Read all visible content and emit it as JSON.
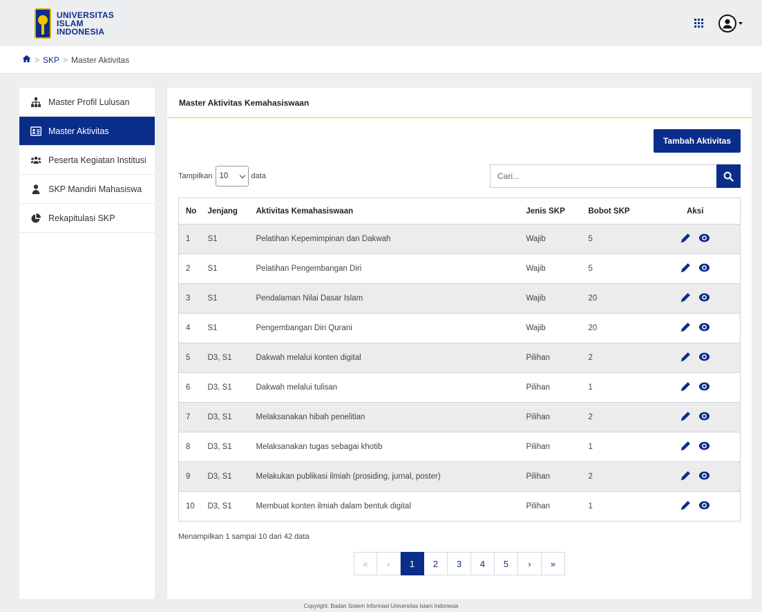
{
  "brand": {
    "line1": "UNIVERSITAS",
    "line2": "ISLAM",
    "line3": "INDONESIA",
    "color": "#0b2d8a",
    "accent": "#e7c24a"
  },
  "topbar": {
    "apps_icon": "apps-grid-icon",
    "user_icon": "user-circle-icon"
  },
  "breadcrumb": {
    "home_icon": "home-icon",
    "sep": ">",
    "items": [
      "SKP",
      "Master Aktivitas"
    ]
  },
  "sidebar": {
    "items": [
      {
        "label": "Master Profil Lulusan",
        "icon": "sitemap-icon",
        "active": false
      },
      {
        "label": "Master Aktivitas",
        "icon": "id-card-icon",
        "active": true
      },
      {
        "label": "Peserta Kegiatan Institusi",
        "icon": "users-icon",
        "active": false
      },
      {
        "label": "SKP Mandiri Mahasiswa",
        "icon": "user-icon",
        "active": false
      },
      {
        "label": "Rekapitulasi SKP",
        "icon": "pie-chart-icon",
        "active": false
      }
    ]
  },
  "main": {
    "title": "Master Aktivitas Kemahasiswaan",
    "add_button": "Tambah Aktivitas",
    "show_label": "Tampilkan",
    "show_value": "10",
    "show_suffix": "data",
    "search_placeholder": "Cari...",
    "table": {
      "headers": [
        "No",
        "Jenjang",
        "Aktivitas Kemahasiswaan",
        "Jenis SKP",
        "Bobot SKP",
        "Aksi"
      ],
      "rows": [
        [
          "1",
          "S1",
          "Pelatihan Kepemimpinan dan Dakwah",
          "Wajib",
          "5"
        ],
        [
          "2",
          "S1",
          "Pelatihan Pengembangan Diri",
          "Wajib",
          "5"
        ],
        [
          "3",
          "S1",
          "Pendalaman Nilai Dasar Islam",
          "Wajib",
          "20"
        ],
        [
          "4",
          "S1",
          "Pengembangan Diri Qurani",
          "Wajib",
          "20"
        ],
        [
          "5",
          "D3, S1",
          "Dakwah melalui konten digital",
          "Pilihan",
          "2"
        ],
        [
          "6",
          "D3, S1",
          "Dakwah melalui tulisan",
          "Pilihan",
          "1"
        ],
        [
          "7",
          "D3, S1",
          "Melaksanakan hibah penelitian",
          "Pilihan",
          "2"
        ],
        [
          "8",
          "D3, S1",
          "Melaksanakan tugas sebagai khotib",
          "Pilihan",
          "1"
        ],
        [
          "9",
          "D3, S1",
          "Melakukan publikasi ilmiah (prosiding, jurnal, poster)",
          "Pilihan",
          "2"
        ],
        [
          "10",
          "D3, S1",
          "Membuat konten ilmiah dalam bentuk digital",
          "Pilihan",
          "1"
        ]
      ],
      "action_icons": [
        "pencil-icon",
        "eye-icon"
      ]
    },
    "info": "Menampilkan 1 sampai 10 dari 42 data",
    "pagination": [
      "«",
      "‹",
      "1",
      "2",
      "3",
      "4",
      "5",
      "›",
      "»"
    ],
    "current_page": "1"
  },
  "footer": "Copyright: Badan Sistem Informasi Universitas Islam Indonesia"
}
